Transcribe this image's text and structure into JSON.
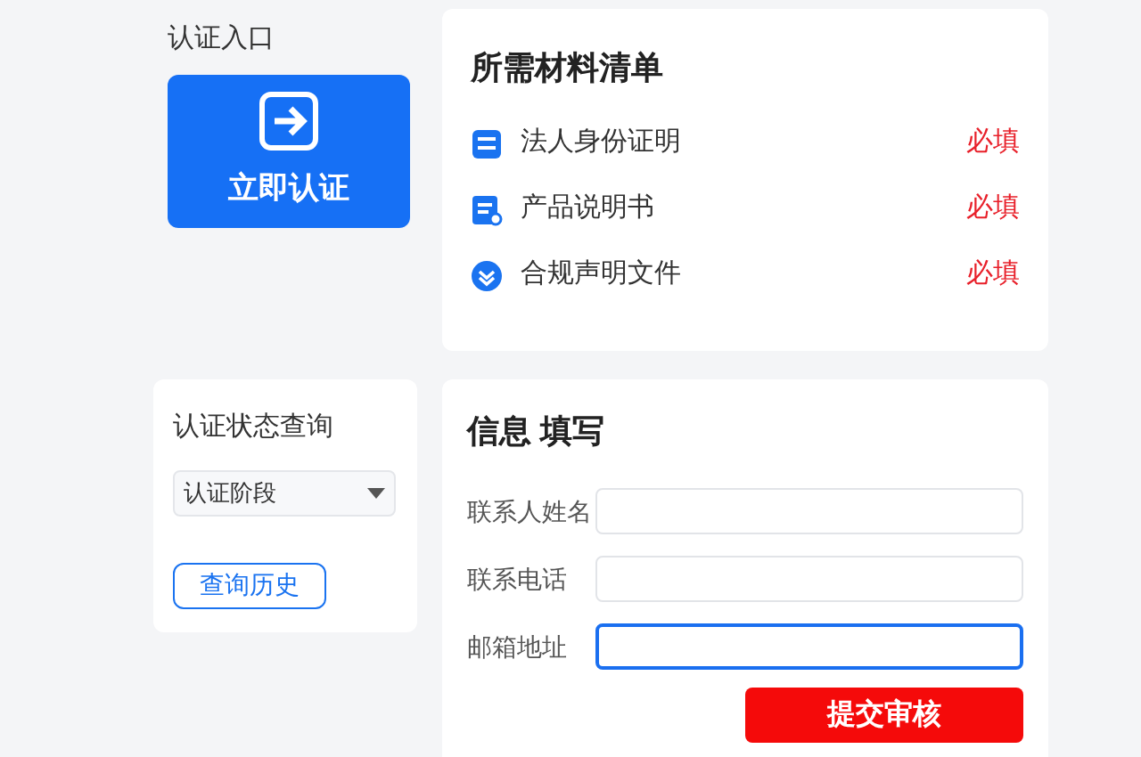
{
  "entry": {
    "label": "认证入口",
    "button": "立即认证"
  },
  "materials": {
    "title": "所需材料清单",
    "items": [
      {
        "kind": "id-card",
        "name": "法人身份证明",
        "tag": "必填"
      },
      {
        "kind": "manual",
        "name": "产品说明书",
        "tag": "必填"
      },
      {
        "kind": "check",
        "name": "合规声明文件",
        "tag": "必填"
      }
    ]
  },
  "status_query": {
    "title": "认证状态查询",
    "select": "认证阶段",
    "button": "查询历史"
  },
  "form": {
    "title": "信息 填写",
    "fields": [
      {
        "label": "联系人姓名",
        "focused": false
      },
      {
        "label": "联系电话",
        "focused": false
      },
      {
        "label": "邮箱地址",
        "focused": true
      }
    ],
    "submit": "提交审核"
  }
}
